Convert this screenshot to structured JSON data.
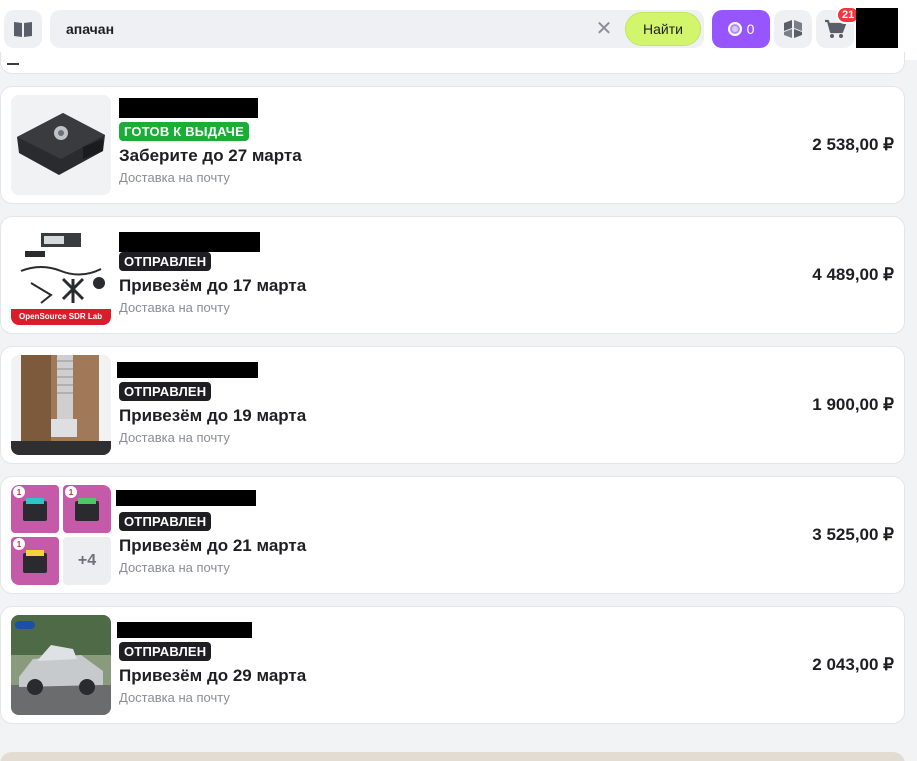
{
  "search": {
    "value": "апачан",
    "clear_icon": "close-icon",
    "submit_label": "Найти"
  },
  "header": {
    "points_count": "0",
    "cart_count": "21"
  },
  "orders": [
    {
      "status": "ГОТОВ К ВЫДАЧЕ",
      "status_kind": "ready",
      "deadline": "Заберите до 27 марта",
      "delivery": "Доставка на почту",
      "price": "2 538,00 ₽"
    },
    {
      "status": "ОТПРАВЛЕН",
      "status_kind": "sent",
      "deadline": "Привезём до 17 марта",
      "delivery": "Доставка на почту",
      "price": "4 489,00 ₽",
      "thumb_caption": "OpenSource SDR Lab"
    },
    {
      "status": "ОТПРАВЛЕН",
      "status_kind": "sent",
      "deadline": "Привезём до 19 марта",
      "delivery": "Доставка на почту",
      "price": "1 900,00 ₽"
    },
    {
      "status": "ОТПРАВЛЕН",
      "status_kind": "sent",
      "deadline": "Привезём до 21 марта",
      "delivery": "Доставка на почту",
      "price": "3 525,00 ₽",
      "more_items": "+4",
      "thumb_badges": [
        "1",
        "1",
        "1"
      ]
    },
    {
      "status": "ОТПРАВЛЕН",
      "status_kind": "sent",
      "deadline": "Привезём до 29 марта",
      "delivery": "Доставка на почту",
      "price": "2 043,00 ₽"
    }
  ],
  "colors": {
    "accent_purple": "#9655ff",
    "find_button": "#d2f56b",
    "ready_badge": "#1aad38",
    "sent_badge": "#1f1f23",
    "cart_badge": "#f5343c"
  }
}
